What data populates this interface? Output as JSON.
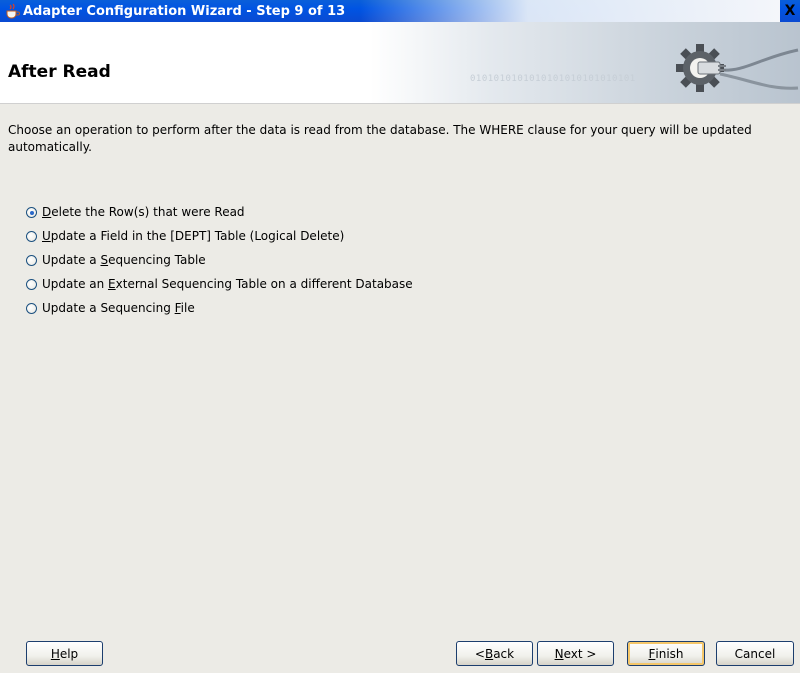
{
  "window": {
    "title": "Adapter Configuration Wizard - Step 9 of 13",
    "close_glyph": "X"
  },
  "banner": {
    "title": "After Read",
    "binary_text": "0101010101010101010101010101"
  },
  "instructions": "Choose an operation to perform after the data is read from the database.  The WHERE clause for your query will be updated automatically.",
  "options": [
    {
      "pre": "",
      "key": "D",
      "post": "elete the Row(s) that were Read",
      "selected": true
    },
    {
      "pre": "",
      "key": "U",
      "post": "pdate a Field in the [DEPT] Table (Logical Delete)",
      "selected": false
    },
    {
      "pre": "Update a ",
      "key": "S",
      "post": "equencing Table",
      "selected": false
    },
    {
      "pre": "Update an ",
      "key": "E",
      "post": "xternal Sequencing Table on a different Database",
      "selected": false
    },
    {
      "pre": "Update a Sequencing ",
      "key": "F",
      "post": "ile",
      "selected": false
    }
  ],
  "buttons": {
    "help": {
      "pre": "",
      "key": "H",
      "post": "elp"
    },
    "back": {
      "pre": "< ",
      "key": "B",
      "post": "ack"
    },
    "next": {
      "pre": "",
      "key": "N",
      "post": "ext >"
    },
    "finish": {
      "pre": "",
      "key": "F",
      "post": "inish"
    },
    "cancel": {
      "pre": "",
      "key": "",
      "post": "Cancel"
    }
  },
  "icons": {
    "title": "java-cup-icon",
    "banner": "gear-plug-icon"
  }
}
